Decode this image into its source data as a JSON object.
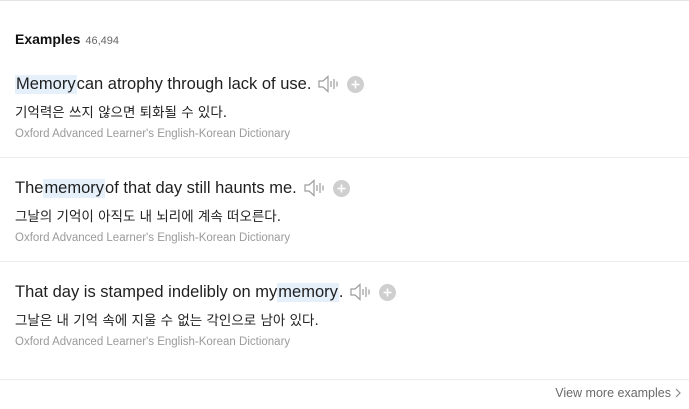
{
  "header": {
    "title": "Examples",
    "count": "46,494"
  },
  "examples": [
    {
      "before": "",
      "highlight": "Memory",
      "after": " can atrophy through lack of use.",
      "korean": "기억력은 쓰지 않으면 퇴화될 수 있다.",
      "source": "Oxford Advanced Learner's English-Korean Dictionary"
    },
    {
      "before": "The ",
      "highlight": "memory",
      "after": " of that day still haunts me.",
      "korean": "그날의 기억이 아직도 내 뇌리에 계속 떠오른다.",
      "source": "Oxford Advanced Learner's English-Korean Dictionary"
    },
    {
      "before": "That day is stamped indelibly on my ",
      "highlight": "memory",
      "after": ".",
      "korean": "그날은 내 기억 속에 지울 수 없는 각인으로 남아 있다.",
      "source": "Oxford Advanced Learner's English-Korean Dictionary"
    }
  ],
  "footer": {
    "more_label": "View more examples"
  },
  "icons": {
    "speaker": "speaker-icon",
    "add": "add-icon",
    "chevron": "chevron-right-icon"
  },
  "colors": {
    "highlight_bg": "#e6f0fb",
    "source_text": "#9a9a9a",
    "icon_gray": "#b5b5b5"
  }
}
